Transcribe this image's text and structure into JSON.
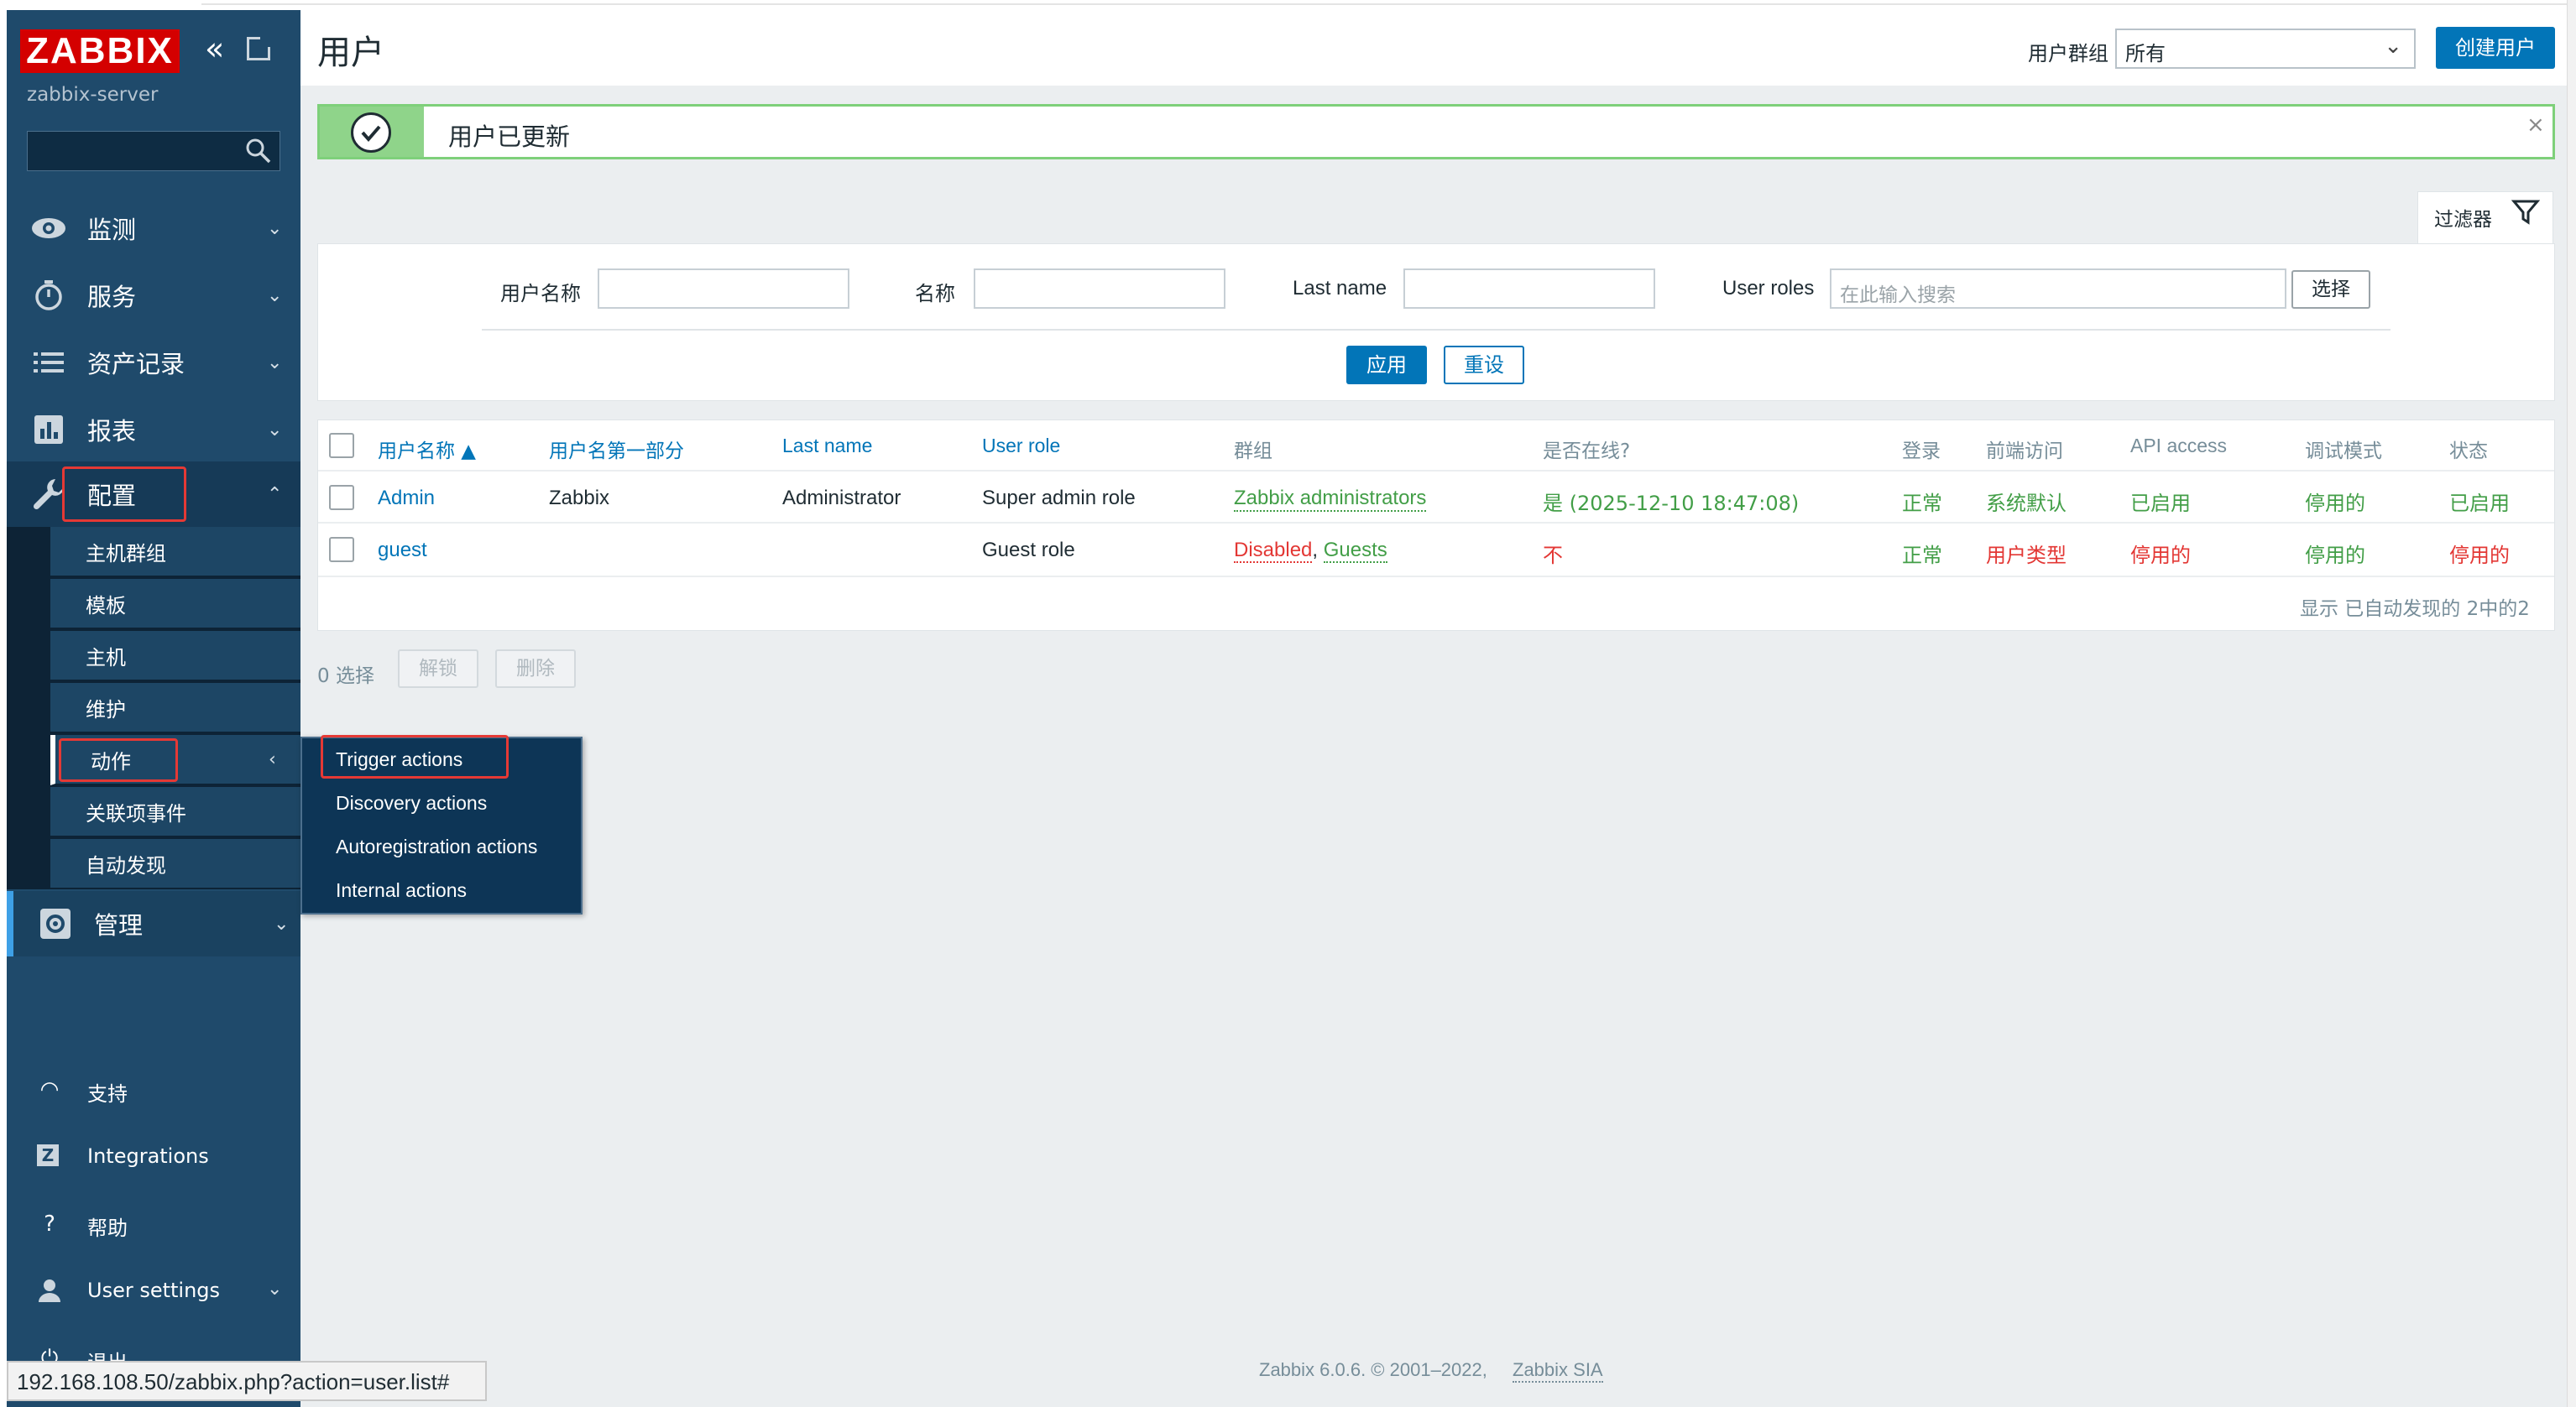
{
  "sidebar": {
    "logo": "ZABBIX",
    "server_name": "zabbix-server",
    "search_placeholder": "",
    "nav": [
      {
        "label": "监测",
        "icon": "eye-icon"
      },
      {
        "label": "服务",
        "icon": "stopwatch-icon"
      },
      {
        "label": "资产记录",
        "icon": "list-icon"
      },
      {
        "label": "报表",
        "icon": "bar-chart-icon"
      },
      {
        "label": "配置",
        "icon": "wrench-icon"
      }
    ],
    "config_sub": [
      "主机群组",
      "模板",
      "主机",
      "维护",
      "动作",
      "关联项事件",
      "自动发现"
    ],
    "admin": {
      "label": "管理",
      "icon": "gear-icon"
    },
    "footer": [
      {
        "label": "支持",
        "icon": "headset-icon"
      },
      {
        "label": "Integrations",
        "icon": "z-logo-icon"
      },
      {
        "label": "帮助",
        "icon": "question-icon"
      },
      {
        "label": "User settings",
        "icon": "user-icon"
      },
      {
        "label": "退出",
        "icon": "power-icon"
      }
    ]
  },
  "header": {
    "title": "用户",
    "group_label": "用户群组",
    "group_value": "所有",
    "create_button": "创建用户"
  },
  "message": {
    "text": "用户已更新",
    "close": "×"
  },
  "filter": {
    "tab_label": "过滤器",
    "username_label": "用户名称",
    "name_label": "名称",
    "lastname_label": "Last name",
    "roles_label": "User roles",
    "roles_placeholder": "在此输入搜索",
    "select_button": "选择",
    "apply_button": "应用",
    "reset_button": "重设"
  },
  "table": {
    "headers": [
      "用户名称 ▲",
      "用户名第一部分",
      "Last name",
      "User role",
      "群组",
      "是否在线?",
      "登录",
      "前端访问",
      "API access",
      "调试模式",
      "状态"
    ],
    "rows": [
      {
        "username": "Admin",
        "name": "Zabbix",
        "surname": "Administrator",
        "role": "Super admin role",
        "groups": [
          "Zabbix administrators"
        ],
        "online": "是 (2025-12-10 18:47:08)",
        "login": "正常",
        "frontend": "系统默认",
        "api": "已启用",
        "debug": "停用的",
        "status": "已启用"
      },
      {
        "username": "guest",
        "name": "",
        "surname": "",
        "role": "Guest role",
        "groups": [
          "Disabled",
          "Guests"
        ],
        "online": "不",
        "login": "正常",
        "frontend": "用户类型",
        "api": "停用的",
        "debug": "停用的",
        "status": "停用的"
      }
    ],
    "footer": "显示 已自动发现的 2中的2"
  },
  "actions_bar": {
    "selected": "0 选择",
    "unlock": "解锁",
    "delete": "删除"
  },
  "popup_menu": [
    "Trigger actions",
    "Discovery actions",
    "Autoregistration actions",
    "Internal actions"
  ],
  "footer": {
    "text": "Zabbix 6.0.6. © 2001–2022,",
    "link": "Zabbix SIA"
  },
  "status_url": "192.168.108.50/zabbix.php?action=user.list#",
  "colors": {
    "sidebar": "#1f4a6b",
    "accent": "#0275b8",
    "success": "#429e47",
    "error": "#e33734",
    "highlight": "#e53935"
  }
}
